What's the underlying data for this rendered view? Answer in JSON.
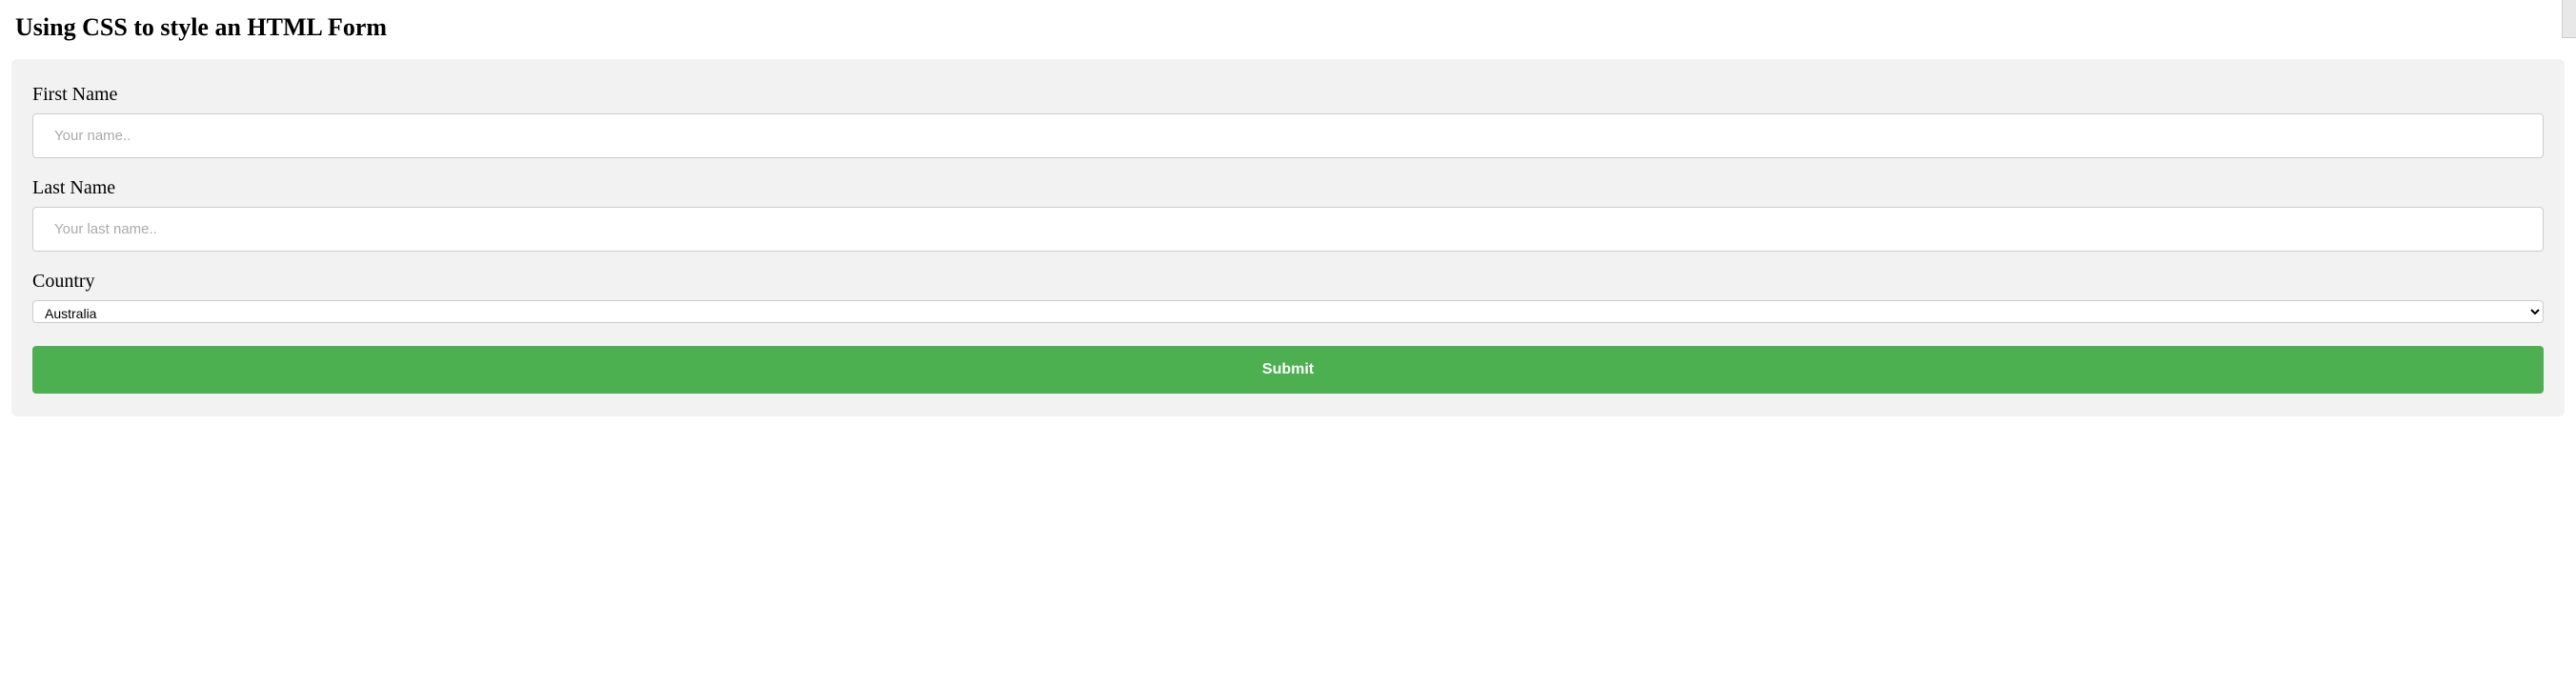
{
  "heading": "Using CSS to style an HTML Form",
  "form": {
    "firstName": {
      "label": "First Name",
      "placeholder": "Your name..",
      "value": ""
    },
    "lastName": {
      "label": "Last Name",
      "placeholder": "Your last name..",
      "value": ""
    },
    "country": {
      "label": "Country",
      "selected": "Australia"
    },
    "submitLabel": "Submit"
  }
}
